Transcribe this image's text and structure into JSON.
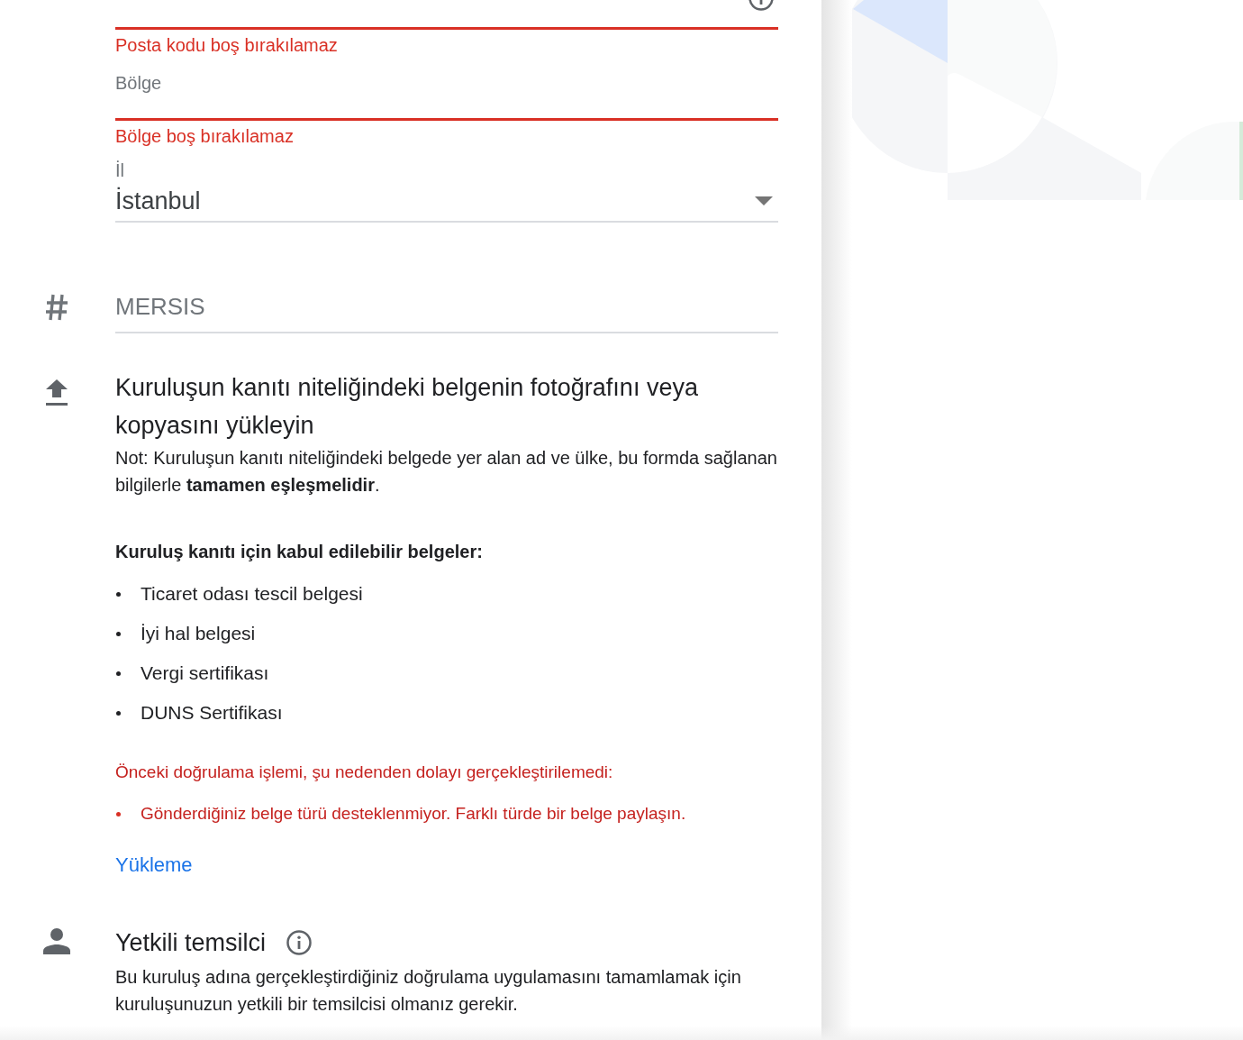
{
  "address_fields": [
    {
      "kind": "text",
      "error": "Posta kodu boş bırakılamaz"
    },
    {
      "kind": "text",
      "label": "Bölge",
      "error": "Bölge boş bırakılamaz"
    },
    {
      "kind": "select",
      "label": "İl",
      "value": "İstanbul"
    }
  ],
  "mersis": {
    "placeholder": "MERSIS"
  },
  "upload": {
    "title": "Kuruluşun kanıtı niteliğindeki belgenin fotoğrafını veya kopyasını yükleyin",
    "note": "Not: Kuruluşun kanıtı niteliğindeki belgede yer alan ad ve ülke, bu formda sağlanan bilgilerle **tamamen eşleşmelidir**.",
    "list_title": "Kuruluş kanıtı için kabul edilebilir belgeler:",
    "documents": [
      "Ticaret odası tescil belgesi",
      "İyi hal belgesi",
      "Vergi sertifikası",
      "DUNS Sertifikası"
    ],
    "error_title": "Önceki doğrulama işlemi, şu nedenden dolayı gerçekleştirilemedi:",
    "errors": [
      "Gönderdiğiniz belge türü desteklenmiyor. Farklı türde bir belge paylaşın."
    ],
    "link": "Yükleme"
  },
  "representative": {
    "title": "Yetkili temsilci",
    "description": "Bu kuruluş adına gerçekleştirdiğiniz doğrulama uygulamasını tamamlamak için kuruluşunuzun yetkili bir temsilcisi olmanız gerekir."
  }
}
